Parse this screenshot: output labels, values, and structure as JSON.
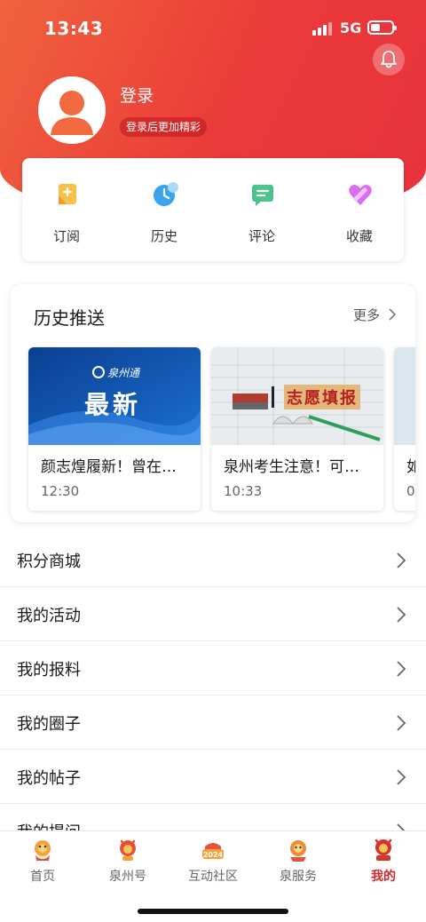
{
  "status_bar": {
    "time": "13:43",
    "network": "5G"
  },
  "profile": {
    "login_label": "登录",
    "login_hint": "登录后更加精彩"
  },
  "quick_actions": [
    {
      "label": "订阅",
      "icon": "subscribe-icon"
    },
    {
      "label": "历史",
      "icon": "history-icon"
    },
    {
      "label": "评论",
      "icon": "comment-icon"
    },
    {
      "label": "收藏",
      "icon": "favorite-icon"
    }
  ],
  "history_push": {
    "title": "历史推送",
    "more_label": "更多",
    "items": [
      {
        "thumb_brand": "泉州通",
        "thumb_headline": "最新",
        "title": "颜志煌履新！曾在…",
        "time": "12:30"
      },
      {
        "thumb_headline": "志愿填报",
        "title": "泉州考生注意！可…",
        "time": "10:33"
      },
      {
        "title": "如",
        "time": "0"
      }
    ]
  },
  "menu": [
    {
      "label": "积分商城"
    },
    {
      "label": "我的活动"
    },
    {
      "label": "我的报料"
    },
    {
      "label": "我的圈子"
    },
    {
      "label": "我的帖子"
    },
    {
      "label": "我的提问"
    }
  ],
  "tab_bar": [
    {
      "label": "首页",
      "icon": "home-dragon-icon"
    },
    {
      "label": "泉州号",
      "icon": "quanzhou-dragon-icon"
    },
    {
      "label": "互动社区",
      "icon": "community-2024-icon",
      "badge": "2024"
    },
    {
      "label": "泉服务",
      "icon": "service-dragon-icon"
    },
    {
      "label": "我的",
      "icon": "mine-dragon-icon",
      "active": true
    }
  ],
  "colors": {
    "brand_red": "#e8323d",
    "brand_orange": "#f0623c",
    "active_tab": "#d42626"
  }
}
